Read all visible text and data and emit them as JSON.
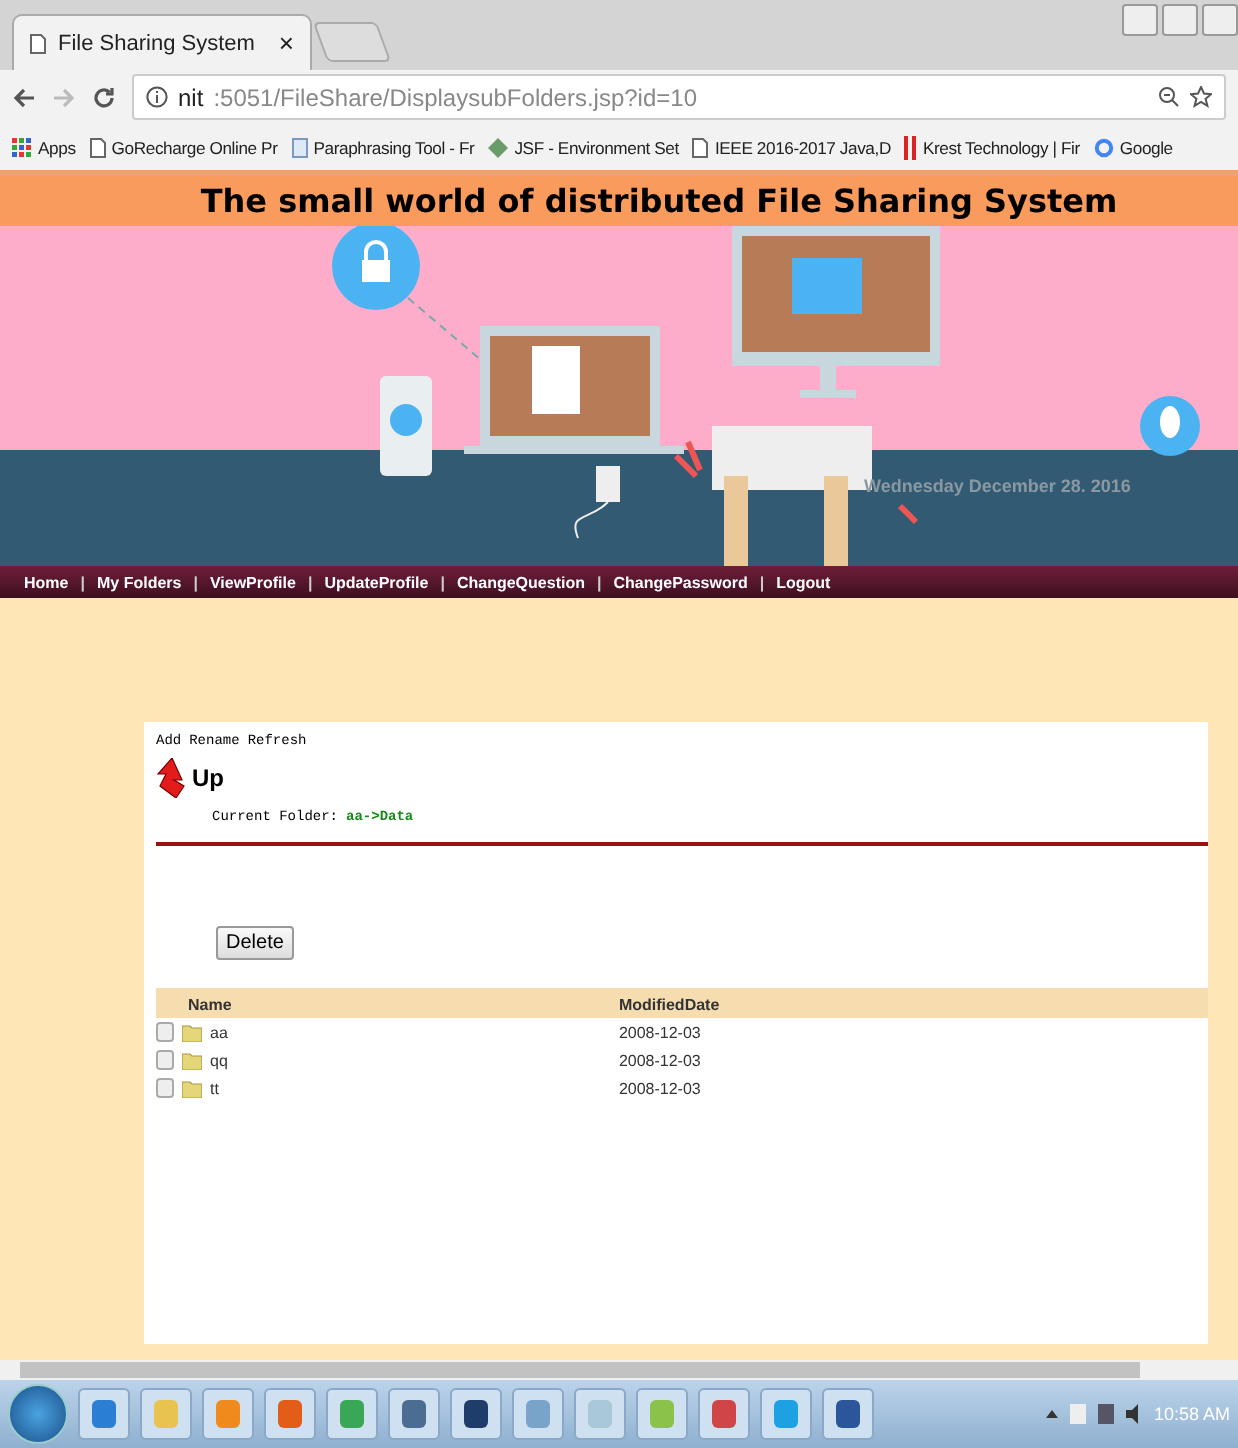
{
  "browser": {
    "tab_title": "File Sharing System",
    "tab_close": "×",
    "url_host": "nit",
    "url_rest": ":5051/FileShare/DisplaysubFolders.jsp?id=10",
    "bookmarks": [
      {
        "kind": "apps",
        "label": "Apps"
      },
      {
        "kind": "page",
        "label": "GoRecharge Online Pr"
      },
      {
        "kind": "doc",
        "label": "Paraphrasing Tool - Fr"
      },
      {
        "kind": "diamond",
        "label": "JSF - Environment Set"
      },
      {
        "kind": "page",
        "label": "IEEE 2016-2017 Java,D"
      },
      {
        "kind": "bars",
        "label": "Krest Technology | Fir"
      },
      {
        "kind": "google",
        "label": "Google"
      }
    ]
  },
  "header": {
    "title": "The small world of distributed File Sharing System",
    "date": "Wednesday December 28. 2016"
  },
  "nav": {
    "separator": "|",
    "items": [
      "Home",
      "My Folders",
      "ViewProfile",
      "UpdateProfile",
      "ChangeQuestion",
      "ChangePassword",
      "Logout"
    ]
  },
  "panel": {
    "actions": [
      "Add",
      "Rename",
      "Refresh"
    ],
    "up_label": "Up",
    "current_folder_label": "Current Folder:",
    "current_folder_path": "aa->Data",
    "delete_button": "Delete",
    "table": {
      "columns": [
        "Name",
        "ModifiedDate"
      ],
      "rows": [
        {
          "name": "aa",
          "date": "2008-12-03",
          "checked": false
        },
        {
          "name": "qq",
          "date": "2008-12-03",
          "checked": false
        },
        {
          "name": "tt",
          "date": "2008-12-03",
          "checked": false
        }
      ]
    }
  },
  "taskbar": {
    "clock": "10:58 AM"
  }
}
